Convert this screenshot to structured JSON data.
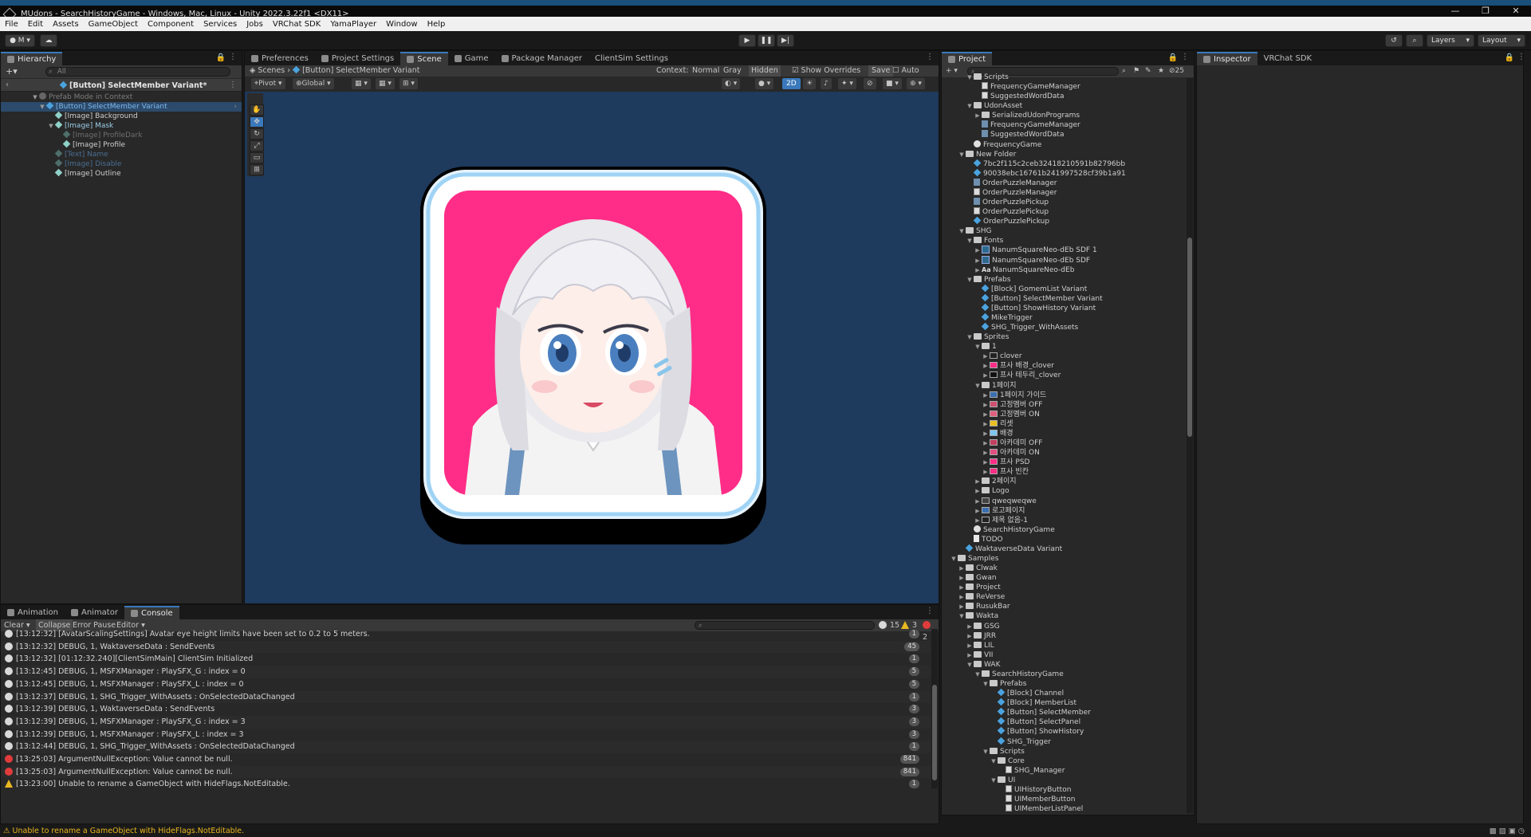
{
  "window": {
    "title": "MUdons - SearchHistoryGame - Windows, Mac, Linux - Unity 2022.3.22f1 <DX11>"
  },
  "menu": [
    "File",
    "Edit",
    "Assets",
    "GameObject",
    "Component",
    "Services",
    "Jobs",
    "VRChat SDK",
    "YamaPlayer",
    "Window",
    "Help"
  ],
  "toolbar": {
    "account": "M",
    "layers": "Layers",
    "layout": "Layout"
  },
  "hierarchy": {
    "tab": "Hierarchy",
    "search_placeholder": "All",
    "prefab_title": "[Button] SelectMember Variant*",
    "items": [
      {
        "label": "Prefab Mode in Context",
        "dim": true
      },
      {
        "label": "[Button] SelectMember Variant",
        "blue": true
      },
      {
        "label": "[Image] Background"
      },
      {
        "label": "[Image] Mask"
      },
      {
        "label": "[Image] ProfileDark",
        "dim": true
      },
      {
        "label": "[Image] Profile"
      },
      {
        "label": "[Text] Name",
        "dim": true
      },
      {
        "label": "[Image] Disable",
        "dim": true
      },
      {
        "label": "[Image] Outline"
      }
    ]
  },
  "center_tabs": [
    "Preferences",
    "Project Settings",
    "Scene",
    "Game",
    "Package Manager",
    "ClientSim Settings"
  ],
  "scene": {
    "breadcrumb_root": "Scenes",
    "breadcrumb_item": "[Button] SelectMember Variant",
    "context_label": "Context:",
    "context_options": [
      "Normal",
      "Gray",
      "Hidden"
    ],
    "show_overrides": "Show Overrides",
    "save": "Save",
    "auto_save": "Auto Save",
    "pivot": "Pivot",
    "global": "Global",
    "mode_2d": "2D"
  },
  "bottom_tabs": [
    "Animation",
    "Animator",
    "Console"
  ],
  "console": {
    "toolbar": [
      "Clear",
      "Collapse",
      "Error Pause",
      "Editor"
    ],
    "counts": {
      "info": "15",
      "warn": "3",
      "error": "2"
    },
    "rows": [
      {
        "type": "info",
        "text": "[13:12:32] [AvatarScalingSettings] Avatar eye height limits have been set to 0.2 to 5 meters.",
        "count": "1"
      },
      {
        "type": "info",
        "text": "[13:12:32] DEBUG, 1, WaktaverseData : SendEvents",
        "count": "45"
      },
      {
        "type": "info",
        "text": "[13:12:32] [01:12:32.240][ClientSimMain] ClientSim Initialized",
        "count": "1"
      },
      {
        "type": "info",
        "text": "[13:12:45] DEBUG, 1, MSFXManager : PlaySFX_G : index = 0",
        "count": "5"
      },
      {
        "type": "info",
        "text": "[13:12:45] DEBUG, 1, MSFXManager : PlaySFX_L : index = 0",
        "count": "5"
      },
      {
        "type": "info",
        "text": "[13:12:37] DEBUG, 1, SHG_Trigger_WithAssets : OnSelectedDataChanged",
        "count": "1"
      },
      {
        "type": "info",
        "text": "[13:12:39] DEBUG, 1, WaktaverseData : SendEvents",
        "count": "3"
      },
      {
        "type": "info",
        "text": "[13:12:39] DEBUG, 1, MSFXManager : PlaySFX_G : index = 3",
        "count": "3"
      },
      {
        "type": "info",
        "text": "[13:12:39] DEBUG, 1, MSFXManager : PlaySFX_L : index = 3",
        "count": "3"
      },
      {
        "type": "info",
        "text": "[13:12:44] DEBUG, 1, SHG_Trigger_WithAssets : OnSelectedDataChanged",
        "count": "1"
      },
      {
        "type": "error",
        "text": "[13:25:03] ArgumentNullException: Value cannot be null.",
        "count": "841"
      },
      {
        "type": "error",
        "text": "[13:25:03] ArgumentNullException: Value cannot be null.",
        "count": "841"
      },
      {
        "type": "warn",
        "text": "[13:23:00] Unable to rename a GameObject with HideFlags.NotEditable.",
        "count": "1"
      }
    ]
  },
  "project": {
    "tab": "Project",
    "hidden_count": "25",
    "items": [
      {
        "label": "Scripts",
        "kind": "folder",
        "depth": 2,
        "open": true
      },
      {
        "label": "FrequencyGameManager",
        "kind": "script",
        "depth": 3
      },
      {
        "label": "SuggestedWordData",
        "kind": "script",
        "depth": 3
      },
      {
        "label": "UdonAsset",
        "kind": "folder",
        "depth": 2,
        "open": true
      },
      {
        "label": "SerializedUdonPrograms",
        "kind": "folder",
        "depth": 3,
        "closed": true
      },
      {
        "label": "FrequencyGameManager",
        "kind": "asset",
        "depth": 3
      },
      {
        "label": "SuggestedWordData",
        "kind": "asset",
        "depth": 3
      },
      {
        "label": "FrequencyGame",
        "kind": "gear",
        "depth": 2
      },
      {
        "label": "New Folder",
        "kind": "folder",
        "depth": 1,
        "open": true
      },
      {
        "label": "7bc2f115c2ceb32418210591b82796bb",
        "kind": "cube",
        "depth": 2
      },
      {
        "label": "90038ebc16761b241997528cf39b1a91",
        "kind": "cube",
        "depth": 2
      },
      {
        "label": "OrderPuzzleManager",
        "kind": "asset",
        "depth": 2
      },
      {
        "label": "OrderPuzzleManager",
        "kind": "script",
        "depth": 2
      },
      {
        "label": "OrderPuzzlePickup",
        "kind": "asset",
        "depth": 2
      },
      {
        "label": "OrderPuzzlePickup",
        "kind": "script",
        "depth": 2
      },
      {
        "label": "OrderPuzzlePickup",
        "kind": "cube",
        "depth": 2
      },
      {
        "label": "SHG",
        "kind": "folder",
        "depth": 1,
        "open": true
      },
      {
        "label": "Fonts",
        "kind": "folder",
        "depth": 2,
        "open": true
      },
      {
        "label": "NanumSquareNeo-dEb SDF 1",
        "kind": "font",
        "depth": 3,
        "closed": true
      },
      {
        "label": "NanumSquareNeo-dEb SDF",
        "kind": "font",
        "depth": 3,
        "closed": true
      },
      {
        "label": "NanumSquareNeo-dEb",
        "kind": "aa",
        "depth": 3,
        "closed": true
      },
      {
        "label": "Prefabs",
        "kind": "folder",
        "depth": 2,
        "open": true
      },
      {
        "label": "[Block] GomemList Variant",
        "kind": "cube",
        "depth": 3
      },
      {
        "label": "[Button] SelectMember Variant",
        "kind": "cube",
        "depth": 3
      },
      {
        "label": "[Button] ShowHistory Variant",
        "kind": "cube",
        "depth": 3
      },
      {
        "label": "MikeTrigger",
        "kind": "cube",
        "depth": 3
      },
      {
        "label": "SHG_Trigger_WithAssets",
        "kind": "cube",
        "depth": 3
      },
      {
        "label": "Sprites",
        "kind": "folder",
        "depth": 2,
        "open": true
      },
      {
        "label": "1",
        "kind": "folder",
        "depth": 3,
        "open": true
      },
      {
        "label": "clover",
        "kind": "sprite",
        "color": "#222222",
        "depth": 4,
        "closed": true
      },
      {
        "label": "프사 배경_clover",
        "kind": "sprite",
        "color": "#ff2d87",
        "depth": 4,
        "closed": true
      },
      {
        "label": "프사 테두리_clover",
        "kind": "sprite",
        "color": "#111111",
        "depth": 4,
        "closed": true
      },
      {
        "label": "1페이지",
        "kind": "folder",
        "depth": 3,
        "open": true
      },
      {
        "label": "1페이지 가이드",
        "kind": "sprite",
        "color": "#3a6fb0",
        "depth": 4,
        "closed": true
      },
      {
        "label": "고정멤버 OFF",
        "kind": "sprite",
        "color": "#d05070",
        "depth": 4,
        "closed": true
      },
      {
        "label": "고정멤버 ON",
        "kind": "sprite",
        "color": "#e0607f",
        "depth": 4,
        "closed": true
      },
      {
        "label": "리셋",
        "kind": "sprite",
        "color": "#e9c020",
        "depth": 4,
        "closed": true
      },
      {
        "label": "배경",
        "kind": "sprite",
        "color": "#7ec8f0",
        "depth": 4,
        "closed": true
      },
      {
        "label": "아카데미 OFF",
        "kind": "sprite",
        "color": "#c04060",
        "depth": 4,
        "closed": true
      },
      {
        "label": "아카데미 ON",
        "kind": "sprite",
        "color": "#e05080",
        "depth": 4,
        "closed": true
      },
      {
        "label": "프사 PSD",
        "kind": "sprite",
        "color": "#ff2d87",
        "depth": 4,
        "closed": true
      },
      {
        "label": "프사 빈칸",
        "kind": "sprite",
        "color": "#ff2d87",
        "depth": 4,
        "closed": true
      },
      {
        "label": "2페이지",
        "kind": "folder",
        "depth": 3,
        "closed": true
      },
      {
        "label": "Logo",
        "kind": "folder",
        "depth": 3,
        "closed": true
      },
      {
        "label": "qweqweqwe",
        "kind": "sprite",
        "color": "#444444",
        "depth": 3,
        "closed": true
      },
      {
        "label": "로고페이지",
        "kind": "sprite",
        "color": "#3a6fb0",
        "depth": 3,
        "closed": true
      },
      {
        "label": "제목 없음-1",
        "kind": "sprite",
        "color": "#222222",
        "depth": 3,
        "closed": true
      },
      {
        "label": "SearchHistoryGame",
        "kind": "gear",
        "depth": 2
      },
      {
        "label": "TODO",
        "kind": "file",
        "depth": 2
      },
      {
        "label": "WaktaverseData Variant",
        "kind": "cube",
        "depth": 1
      },
      {
        "label": "Samples",
        "kind": "folder",
        "depth": 0,
        "open": true
      },
      {
        "label": "Clwak",
        "kind": "folder",
        "depth": 1,
        "closed": true
      },
      {
        "label": "Gwan",
        "kind": "folder",
        "depth": 1,
        "closed": true
      },
      {
        "label": "Project",
        "kind": "folder",
        "depth": 1,
        "closed": true
      },
      {
        "label": "ReVerse",
        "kind": "folder",
        "depth": 1,
        "closed": true
      },
      {
        "label": "RusukBar",
        "kind": "folder",
        "depth": 1,
        "closed": true
      },
      {
        "label": "Wakta",
        "kind": "folder",
        "depth": 1,
        "open": true
      },
      {
        "label": "GSG",
        "kind": "folder",
        "depth": 2,
        "closed": true
      },
      {
        "label": "JRR",
        "kind": "folder",
        "depth": 2,
        "closed": true
      },
      {
        "label": "LIL",
        "kind": "folder",
        "depth": 2,
        "closed": true
      },
      {
        "label": "VII",
        "kind": "folder",
        "depth": 2,
        "closed": true
      },
      {
        "label": "WAK",
        "kind": "folder",
        "depth": 2,
        "open": true
      },
      {
        "label": "SearchHistoryGame",
        "kind": "folder",
        "depth": 3,
        "open": true
      },
      {
        "label": "Prefabs",
        "kind": "folder",
        "depth": 4,
        "open": true
      },
      {
        "label": "[Block] Channel",
        "kind": "cube",
        "depth": 5
      },
      {
        "label": "[Block] MemberList",
        "kind": "cube",
        "depth": 5
      },
      {
        "label": "[Button] SelectMember",
        "kind": "cube",
        "depth": 5
      },
      {
        "label": "[Button] SelectPanel",
        "kind": "cube",
        "depth": 5
      },
      {
        "label": "[Button] ShowHistory",
        "kind": "cube",
        "depth": 5
      },
      {
        "label": "SHG_Trigger",
        "kind": "cube",
        "depth": 5
      },
      {
        "label": "Scripts",
        "kind": "folder",
        "depth": 4,
        "open": true
      },
      {
        "label": "Core",
        "kind": "folder",
        "depth": 5,
        "open": true
      },
      {
        "label": "SHG_Manager",
        "kind": "script",
        "depth": 6
      },
      {
        "label": "UI",
        "kind": "folder",
        "depth": 5,
        "open": true
      },
      {
        "label": "UIHistoryButton",
        "kind": "script",
        "depth": 6
      },
      {
        "label": "UIMemberButton",
        "kind": "script",
        "depth": 6
      },
      {
        "label": "UIMemberListPanel",
        "kind": "script",
        "depth": 6
      }
    ]
  },
  "inspector": {
    "tabs": [
      "Inspector",
      "VRChat SDK"
    ]
  },
  "status": {
    "text": "Unable to rename a GameObject with HideFlags.NotEditable."
  },
  "colors": {
    "accent": "#3a79bb",
    "scene_bg": "#1e3a5c",
    "avatar_bg": "#ff2d87",
    "error": "#e23b3b",
    "warning": "#e9b820"
  },
  "icons": [
    "unity-logo-icon",
    "play-icon",
    "pause-icon",
    "step-icon",
    "search-icon",
    "history-icon",
    "cloud-icon",
    "lock-icon",
    "kebab-icon"
  ]
}
